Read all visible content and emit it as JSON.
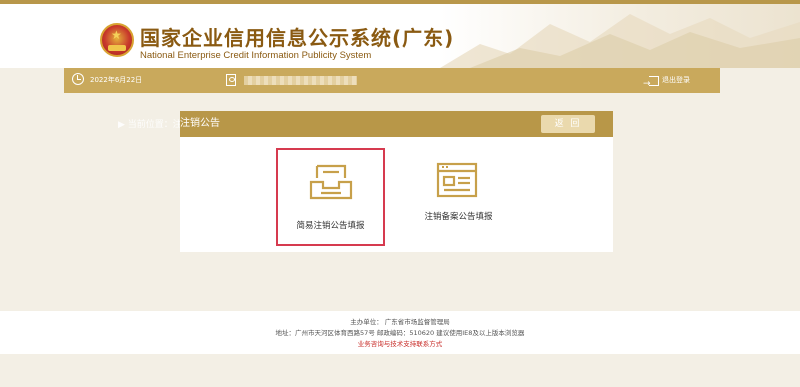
{
  "header": {
    "title_cn": "国家企业信用信息公示系统(广东)",
    "title_en": "National Enterprise Credit Information Publicity System"
  },
  "infobar": {
    "date": "2022年6月22日",
    "logout_label": "退出登录"
  },
  "breadcrumb": "▶ 当前位置：注销公告",
  "panel": {
    "title": "注销公告",
    "back_label": "返 回",
    "options": [
      {
        "label": "简易注销公告填报",
        "icon": "inbox-tray-icon"
      },
      {
        "label": "注销备案公告填报",
        "icon": "form-document-icon"
      }
    ]
  },
  "footer": {
    "host": "主办单位：  广东省市场监督管理局",
    "address": "地址：广州市天河区体育西路57号    邮政编码：510620    建议使用IE8及以上版本浏览器",
    "support_link": "业务咨询与技术支持联系方式"
  },
  "colors": {
    "gold_dark": "#8a5a12",
    "gold_bar": "#c9a95c",
    "panel_head": "#b89748",
    "highlight_red": "#d63a4f",
    "background": "#f3efe5"
  }
}
